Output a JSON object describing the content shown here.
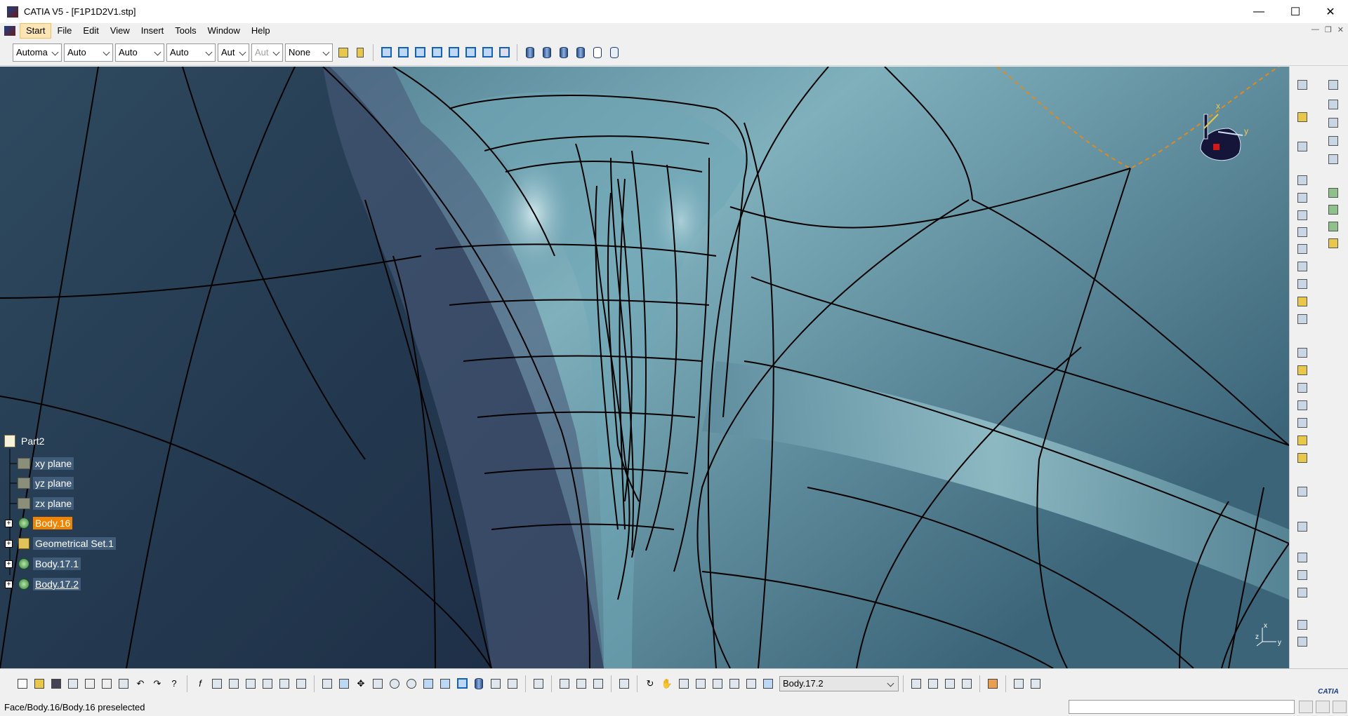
{
  "window": {
    "title": "CATIA V5 - [F1P1D2V1.stp]",
    "min_icon": "minimize-icon",
    "max_icon": "maximize-icon",
    "close_icon": "close-icon"
  },
  "menu": {
    "items": [
      "Start",
      "File",
      "Edit",
      "View",
      "Insert",
      "Tools",
      "Window",
      "Help"
    ],
    "active": "Start"
  },
  "graphic_toolbar": {
    "combos": [
      "Automa",
      "Auto",
      "Auto",
      "Auto",
      "Aut",
      "Aut",
      "None"
    ],
    "disabled_combo_index": 5
  },
  "compass": {
    "x_label": "x",
    "y_label": "y"
  },
  "axis_triad": {
    "x_label": "x",
    "y_label": "y",
    "z_label": "z"
  },
  "tree": {
    "root": "Part2",
    "items": [
      {
        "label": "xy plane",
        "icon": "plane-icon",
        "expandable": false,
        "state": "normal"
      },
      {
        "label": "yz plane",
        "icon": "plane-icon",
        "expandable": false,
        "state": "normal"
      },
      {
        "label": "zx plane",
        "icon": "plane-icon",
        "expandable": false,
        "state": "normal"
      },
      {
        "label": "Body.16",
        "icon": "body-icon",
        "expandable": true,
        "state": "selected"
      },
      {
        "label": "Geometrical Set.1",
        "icon": "geometrical-set-icon",
        "expandable": true,
        "state": "normal"
      },
      {
        "label": "Body.17.1",
        "icon": "body-icon",
        "expandable": true,
        "state": "normal"
      },
      {
        "label": "Body.17.2",
        "icon": "body-icon",
        "expandable": true,
        "state": "underlined"
      }
    ]
  },
  "bottom_toolbar": {
    "current_body": "Body.17.2"
  },
  "status": {
    "message": "Face/Body.16/Body.16 preselected"
  },
  "colors": {
    "selected": "#f08400",
    "viewport_bg": "#4a6f86",
    "highlight": "#e08a1e"
  }
}
